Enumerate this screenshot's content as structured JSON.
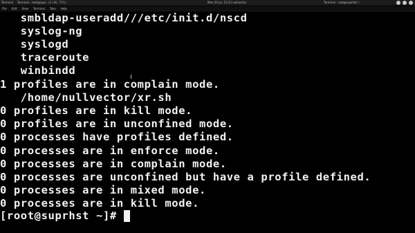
{
  "topbar": {
    "tabs": [
      "Terminal",
      "Terminal - root@supr..."
    ],
    "tray": "[2+89, 75%]",
    "clock": "Mon 20 Jul, 15:23  nullvector",
    "window_title": "Terminal - root@suprhst:~"
  },
  "menubar": {
    "items": [
      "File",
      "Edit",
      "View",
      "Terminal",
      "Tabs",
      "Help"
    ]
  },
  "terminal": {
    "lines": [
      "   smbldap-useradd///etc/init.d/nscd",
      "   syslog-ng",
      "   syslogd",
      "   traceroute",
      "   winbindd",
      "1 profiles are in complain mode.",
      "   /home/nullvector/xr.sh",
      "0 profiles are in kill mode.",
      "0 profiles are in unconfined mode.",
      "0 processes have profiles defined.",
      "0 processes are in enforce mode.",
      "0 processes are in complain mode.",
      "0 processes are unconfined but have a profile defined.",
      "0 processes are in mixed mode.",
      "0 processes are in kill mode."
    ],
    "prompt": "[root@suprhst ~]#"
  }
}
